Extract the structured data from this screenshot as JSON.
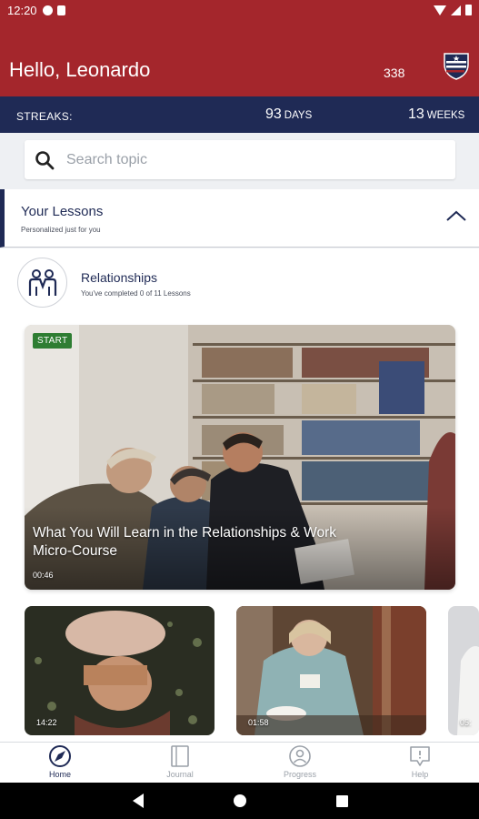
{
  "status_bar": {
    "time": "12:20"
  },
  "header": {
    "greeting": "Hello, Leonardo",
    "points": "338",
    "brand_color": "#a4262c"
  },
  "streaks": {
    "label": "STREAKS:",
    "days_value": "93",
    "days_unit": "DAYS",
    "weeks_value": "13",
    "weeks_unit": "WEEKS",
    "bar_color": "#1f2a55"
  },
  "search": {
    "placeholder": "Search topic",
    "value": ""
  },
  "lessons": {
    "title": "Your Lessons",
    "subtitle": "Personalized just for you",
    "course": {
      "name": "Relationships",
      "progress_text": "You've completed 0 of 11 Lessons",
      "icon": "people-icon"
    },
    "featured": {
      "badge": "START",
      "title": "What You Will Learn in the Relationships & Work Micro-Course",
      "duration": "00:46"
    },
    "videos": [
      {
        "duration": "14:22"
      },
      {
        "duration": "01:58"
      },
      {
        "duration": "05:"
      }
    ]
  },
  "bottom_nav": {
    "items": [
      {
        "label": "Home",
        "icon": "compass-icon",
        "active": true
      },
      {
        "label": "Journal",
        "icon": "journal-icon",
        "active": false
      },
      {
        "label": "Progress",
        "icon": "person-icon",
        "active": false
      },
      {
        "label": "Help",
        "icon": "help-bubble-icon",
        "active": false
      }
    ]
  }
}
